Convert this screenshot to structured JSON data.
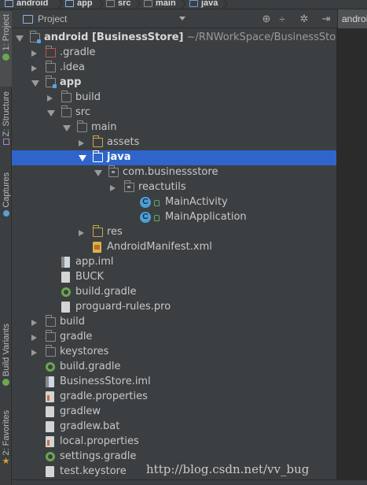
{
  "breadcrumb": [
    "android",
    "app",
    "src",
    "main",
    "java"
  ],
  "left_tabs": {
    "project": "1: Project",
    "structure": "Z: Structure",
    "captures": "Captures",
    "build_variants": "Build Variants",
    "favorites": "2: Favorites"
  },
  "panel": {
    "title": "Project",
    "header_icons": [
      "target-icon",
      "sort-icon",
      "gear-icon",
      "hide-icon"
    ]
  },
  "editor_tab": "androidP",
  "tree": [
    {
      "label": "android",
      "suffix": " [BusinessStore]",
      "path": " ~/RNWorkSpace/BusinessStore/android",
      "indent": 0,
      "arrow": "down",
      "icon": "folder-mod",
      "bold": true
    },
    {
      "label": ".gradle",
      "indent": 1,
      "arrow": "right",
      "icon": "folder-red"
    },
    {
      "label": ".idea",
      "indent": 1,
      "arrow": "right",
      "icon": "folder"
    },
    {
      "label": "app",
      "indent": 1,
      "arrow": "down",
      "icon": "folder-mod",
      "bold": true
    },
    {
      "label": "build",
      "indent": 2,
      "arrow": "right",
      "icon": "folder"
    },
    {
      "label": "src",
      "indent": 2,
      "arrow": "down",
      "icon": "folder"
    },
    {
      "label": "main",
      "indent": 3,
      "arrow": "down",
      "icon": "folder"
    },
    {
      "label": "assets",
      "indent": 4,
      "arrow": "right",
      "icon": "folder-res"
    },
    {
      "label": "java",
      "indent": 4,
      "arrow": "down",
      "icon": "folder-src",
      "selected": true
    },
    {
      "label": "com.businessstore",
      "indent": 5,
      "arrow": "down",
      "icon": "folder-pkg"
    },
    {
      "label": "reactutils",
      "indent": 6,
      "arrow": "right",
      "icon": "folder-pkg"
    },
    {
      "label": "MainActivity",
      "indent": 7,
      "arrow": "none",
      "icon": "class"
    },
    {
      "label": "MainApplication",
      "indent": 7,
      "arrow": "none",
      "icon": "class"
    },
    {
      "label": "res",
      "indent": 4,
      "arrow": "right",
      "icon": "folder-res"
    },
    {
      "label": "AndroidManifest.xml",
      "indent": 4,
      "arrow": "none",
      "icon": "xml"
    },
    {
      "label": "app.iml",
      "indent": 2,
      "arrow": "none",
      "icon": "iml"
    },
    {
      "label": "BUCK",
      "indent": 2,
      "arrow": "none",
      "icon": "file"
    },
    {
      "label": "build.gradle",
      "indent": 2,
      "arrow": "none",
      "icon": "gradle"
    },
    {
      "label": "proguard-rules.pro",
      "indent": 2,
      "arrow": "none",
      "icon": "file"
    },
    {
      "label": "build",
      "indent": 1,
      "arrow": "right",
      "icon": "folder"
    },
    {
      "label": "gradle",
      "indent": 1,
      "arrow": "right",
      "icon": "folder"
    },
    {
      "label": "keystores",
      "indent": 1,
      "arrow": "right",
      "icon": "folder"
    },
    {
      "label": "build.gradle",
      "indent": 1,
      "arrow": "none",
      "icon": "gradle"
    },
    {
      "label": "BusinessStore.iml",
      "indent": 1,
      "arrow": "none",
      "icon": "iml"
    },
    {
      "label": "gradle.properties",
      "indent": 1,
      "arrow": "none",
      "icon": "props"
    },
    {
      "label": "gradlew",
      "indent": 1,
      "arrow": "none",
      "icon": "file"
    },
    {
      "label": "gradlew.bat",
      "indent": 1,
      "arrow": "none",
      "icon": "file"
    },
    {
      "label": "local.properties",
      "indent": 1,
      "arrow": "none",
      "icon": "props"
    },
    {
      "label": "settings.gradle",
      "indent": 1,
      "arrow": "none",
      "icon": "gradle"
    },
    {
      "label": "test.keystore",
      "indent": 1,
      "arrow": "none",
      "icon": "file"
    }
  ],
  "watermark": "http://blog.csdn.net/vv_bug",
  "colors": {
    "selection": "#2f65ca",
    "background": "#3c3f41",
    "source_folder": "#6fa6e6",
    "resource_folder": "#c9a64a",
    "class_icon": "#4aa0d8",
    "gradle_icon": "#6aa84f"
  }
}
